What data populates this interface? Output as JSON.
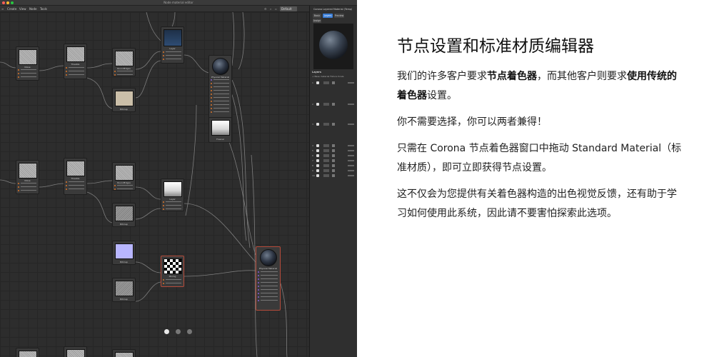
{
  "screenshot": {
    "window_title": "Node material editor",
    "menu": [
      "Create",
      "View",
      "Node",
      "Tools"
    ],
    "preset_dropdown": "Default",
    "nodes": [
      {
        "id": "n1",
        "label": "Noise",
        "thumb": "noise",
        "ports": [
          "Base Shader",
          "Base Shader",
          "Mode"
        ]
      },
      {
        "id": "n2",
        "label": "Tileable",
        "thumb": "noise",
        "ports": [
          "Color",
          "Color",
          "Alpha"
        ]
      },
      {
        "id": "n3",
        "label": "RoundEdges",
        "thumb": "noise",
        "ports": [
          "Alignment",
          "Texture"
        ]
      },
      {
        "id": "n4",
        "label": "Layer",
        "thumb": "sky",
        "ports": [
          "Color",
          "Shader",
          "Alpha"
        ]
      },
      {
        "id": "n5",
        "label": "Bitmap",
        "thumb": "beige",
        "ports": []
      },
      {
        "id": "n6",
        "label": "Physical Material",
        "thumb": "ball",
        "ports": [
          "Color",
          "Color",
          "Roughness",
          "Metal",
          "Bump",
          "Normal",
          "Opacity",
          "Emission",
          "Refraction",
          "Clearcoat"
        ]
      },
      {
        "id": "n7",
        "label": "Fresnel",
        "thumb": "grad",
        "ports": []
      },
      {
        "id": "n8",
        "label": "Noise",
        "thumb": "noise",
        "ports": [
          "Base Shader",
          "Base Shader",
          "Mode"
        ]
      },
      {
        "id": "n9",
        "label": "Tileable",
        "thumb": "noise",
        "ports": [
          "Color",
          "Color",
          "Alpha"
        ]
      },
      {
        "id": "n10",
        "label": "RoundEdges",
        "thumb": "noise",
        "ports": [
          "Alignment",
          "Texture"
        ]
      },
      {
        "id": "n11",
        "label": "Layer",
        "thumb": "grad",
        "ports": [
          "Color",
          "Shader",
          "Alpha"
        ]
      },
      {
        "id": "n12",
        "label": "Bitmap",
        "thumb": "noise2",
        "ports": []
      },
      {
        "id": "n13",
        "label": "Bitmap",
        "thumb": "lav",
        "ports": []
      },
      {
        "id": "n14",
        "label": "Mixing",
        "thumb": "check",
        "ports": [
          "Color",
          "Mask"
        ]
      },
      {
        "id": "n15",
        "label": "Bitmap",
        "thumb": "noise2",
        "ports": []
      },
      {
        "id": "n16",
        "label": "Physical Material",
        "thumb": "ball",
        "ports": [
          "Base Color",
          "Color",
          "Roughness",
          "Metal",
          "Bump",
          "Normal",
          "Opacity",
          "Emission",
          "Refraction"
        ]
      }
    ],
    "panel": {
      "title": "Corona Layered Material (Temp)",
      "tabs": [
        "Basic",
        "Layers",
        "Preview",
        "Assign"
      ],
      "layers_heading": "Layers",
      "layers_sub": "+ Base material   Fixture Scale",
      "layer_numbers": [
        "1",
        "2",
        "3",
        "4",
        "5",
        "6",
        "7",
        "8",
        "9",
        "10"
      ]
    },
    "carousel_dots": 3,
    "carousel_active": 0
  },
  "article": {
    "heading": "节点设置和标准材质编辑器",
    "p1": {
      "t1": "我们的许多客户要求",
      "b1": "节点着色器",
      "t2": "，而其他客户则要求",
      "b2": "使用传统的着色器",
      "t3": "设置。"
    },
    "p2": "你不需要选择，你可以两者兼得！",
    "p3": "只需在 Corona 节点着色器窗口中拖动 Standard Material（标准材质），即可立即获得节点设置。",
    "p4": "这不仅会为您提供有关着色器构造的出色视觉反馈，还有助于学习如何使用此系统，因此请不要害怕探索此选项。"
  },
  "colors": {
    "port_orange": "#d9742b",
    "port_purple": "#8a5cd6",
    "tab_active": "#3b7ed6"
  }
}
